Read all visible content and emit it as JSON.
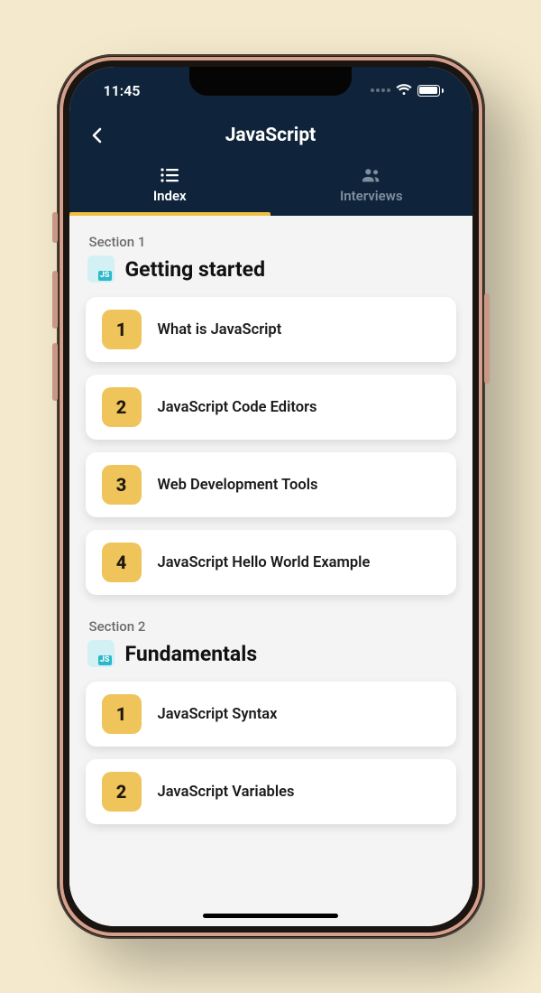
{
  "status": {
    "time": "11:45"
  },
  "header": {
    "title": "JavaScript"
  },
  "tabs": [
    {
      "label": "Index",
      "active": true
    },
    {
      "label": "Interviews",
      "active": false
    }
  ],
  "icon_badge": "JS",
  "sections": [
    {
      "label": "Section 1",
      "title": "Getting started",
      "lessons": [
        {
          "num": "1",
          "title": "What is JavaScript"
        },
        {
          "num": "2",
          "title": "JavaScript Code Editors"
        },
        {
          "num": "3",
          "title": "Web Development Tools"
        },
        {
          "num": "4",
          "title": "JavaScript Hello World Example"
        }
      ]
    },
    {
      "label": "Section 2",
      "title": "Fundamentals",
      "lessons": [
        {
          "num": "1",
          "title": "JavaScript Syntax"
        },
        {
          "num": "2",
          "title": "JavaScript Variables"
        }
      ]
    }
  ]
}
